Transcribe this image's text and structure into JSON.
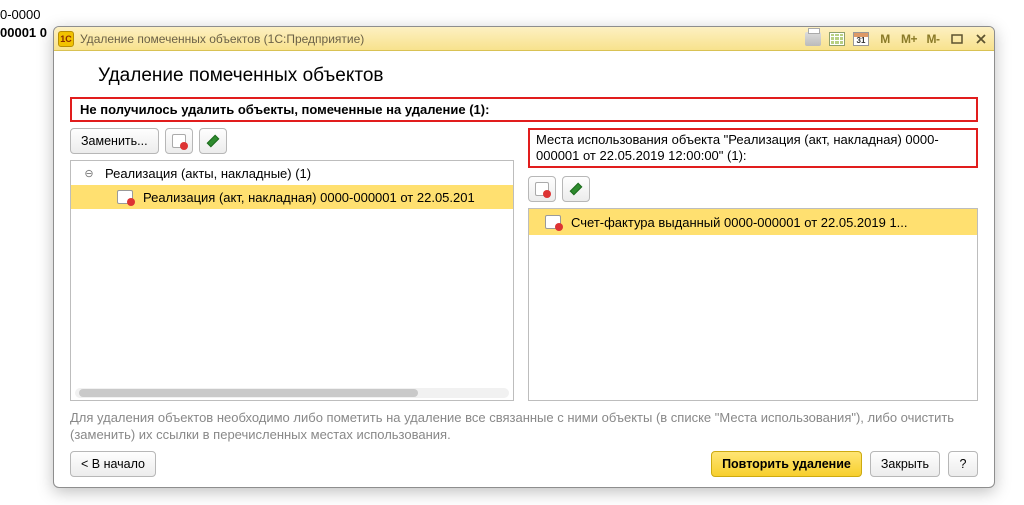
{
  "behind": {
    "line1": "0-0000",
    "line2": "00001 0"
  },
  "titlebar": {
    "app_icon": "1C",
    "title": "Удаление помеченных объектов  (1С:Предприятие)",
    "calendar_day": "31"
  },
  "page": {
    "title": "Удаление помеченных объектов",
    "error_heading": "Не получилось удалить объекты, помеченные на удаление (1):",
    "hint": "Для удаления объектов необходимо либо пометить на удаление все связанные с ними объекты (в списке \"Места использования\"), либо очистить (заменить) их ссылки в перечисленных местах использования."
  },
  "left": {
    "replace_label": "Заменить...",
    "group_label": "Реализация (акты, накладные) (1)",
    "item_label": "Реализация (акт, накладная) 0000-000001 от 22.05.201"
  },
  "right": {
    "heading": "Места использования объекта \"Реализация (акт, накладная) 0000-000001 от 22.05.2019 12:00:00\" (1):",
    "item_label": "Счет-фактура выданный 0000-000001 от 22.05.2019 1..."
  },
  "footer": {
    "back_label": "< В начало",
    "retry_label": "Повторить удаление",
    "close_label": "Закрыть",
    "help_label": "?"
  }
}
